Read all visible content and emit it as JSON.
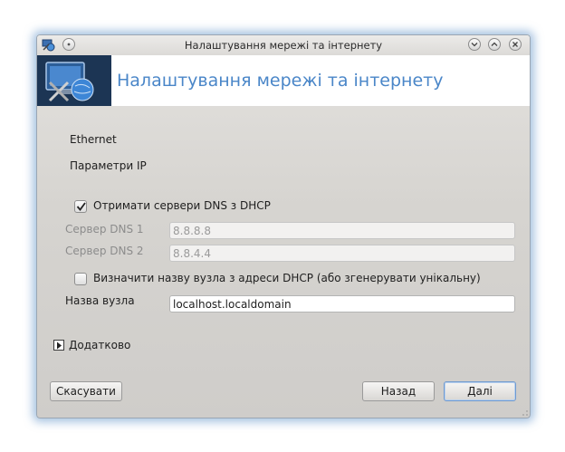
{
  "window": {
    "title": "Налаштування мережі та інтернету"
  },
  "banner": {
    "title": "Налаштування мережі та інтернету"
  },
  "section": {
    "interface_label": "Ethernet",
    "subtitle": "Параметри IP"
  },
  "dns": {
    "from_dhcp_label": "Отримати сервери DNS з DHCP",
    "from_dhcp_checked": true,
    "server1_label": "Сервер DNS 1",
    "server1_value": "8.8.8.8",
    "server2_label": "Сервер DNS 2",
    "server2_value": "8.8.4.4"
  },
  "hostname": {
    "dhcp_label": "Визначити назву вузла з адреси DHCP (або згенерувати унікальну)",
    "dhcp_checked": false,
    "label": "Назва вузла",
    "value": "localhost.localdomain"
  },
  "advanced": {
    "label": "Додатково"
  },
  "buttons": {
    "cancel": "Скасувати",
    "back": "Назад",
    "next": "Далі"
  }
}
